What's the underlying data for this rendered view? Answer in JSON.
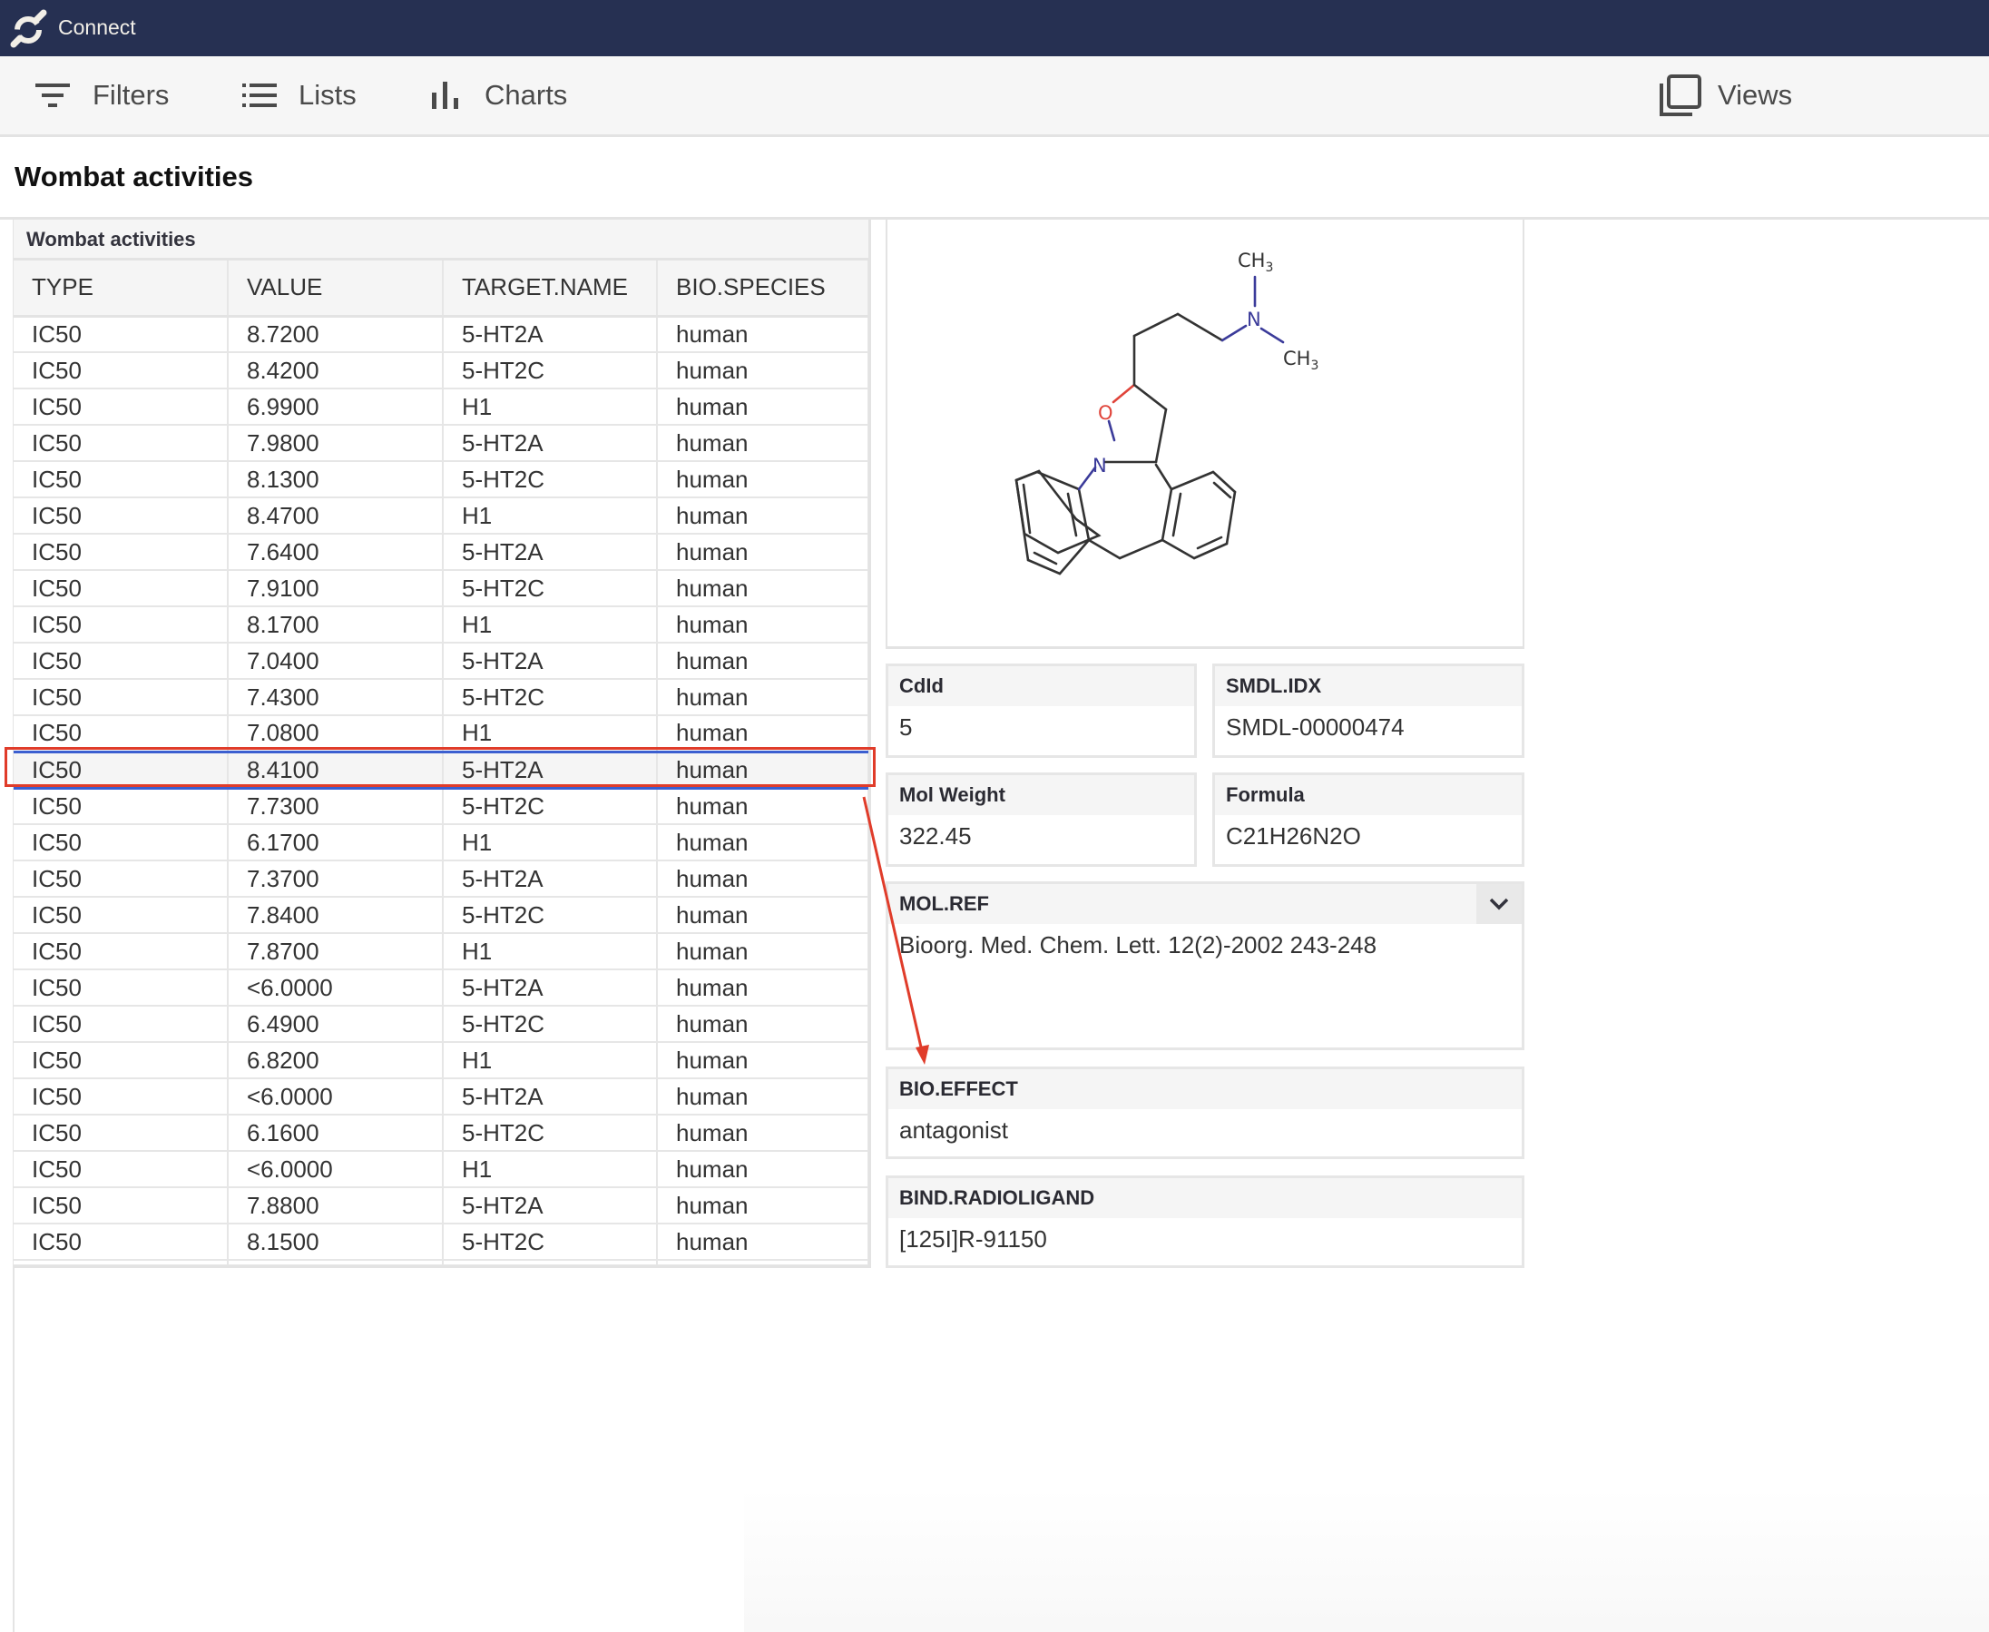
{
  "app": {
    "title": "Connect",
    "logo_icon": "connect-logo-icon",
    "header_color": "#263052"
  },
  "toolbar": {
    "filters_label": "Filters",
    "filters_icon": "filter-icon",
    "lists_label": "Lists",
    "lists_icon": "list-icon",
    "charts_label": "Charts",
    "charts_icon": "bar-chart-icon",
    "views_label": "Views",
    "views_icon": "views-icon"
  },
  "page": {
    "title": "Wombat activities"
  },
  "table": {
    "title": "Wombat activities",
    "columns": [
      "TYPE",
      "VALUE",
      "TARGET.NAME",
      "BIO.SPECIES"
    ],
    "selected_index": 12,
    "rows": [
      [
        "IC50",
        "8.7200",
        "5-HT2A",
        "human"
      ],
      [
        "IC50",
        "8.4200",
        "5-HT2C",
        "human"
      ],
      [
        "IC50",
        "6.9900",
        "H1",
        "human"
      ],
      [
        "IC50",
        "7.9800",
        "5-HT2A",
        "human"
      ],
      [
        "IC50",
        "8.1300",
        "5-HT2C",
        "human"
      ],
      [
        "IC50",
        "8.4700",
        "H1",
        "human"
      ],
      [
        "IC50",
        "7.6400",
        "5-HT2A",
        "human"
      ],
      [
        "IC50",
        "7.9100",
        "5-HT2C",
        "human"
      ],
      [
        "IC50",
        "8.1700",
        "H1",
        "human"
      ],
      [
        "IC50",
        "7.0400",
        "5-HT2A",
        "human"
      ],
      [
        "IC50",
        "7.4300",
        "5-HT2C",
        "human"
      ],
      [
        "IC50",
        "7.0800",
        "H1",
        "human"
      ],
      [
        "IC50",
        "8.4100",
        "5-HT2A",
        "human"
      ],
      [
        "IC50",
        "7.7300",
        "5-HT2C",
        "human"
      ],
      [
        "IC50",
        "6.1700",
        "H1",
        "human"
      ],
      [
        "IC50",
        "7.3700",
        "5-HT2A",
        "human"
      ],
      [
        "IC50",
        "7.8400",
        "5-HT2C",
        "human"
      ],
      [
        "IC50",
        "7.8700",
        "H1",
        "human"
      ],
      [
        "IC50",
        "<6.0000",
        "5-HT2A",
        "human"
      ],
      [
        "IC50",
        "6.4900",
        "5-HT2C",
        "human"
      ],
      [
        "IC50",
        "6.8200",
        "H1",
        "human"
      ],
      [
        "IC50",
        "<6.0000",
        "5-HT2A",
        "human"
      ],
      [
        "IC50",
        "6.1600",
        "5-HT2C",
        "human"
      ],
      [
        "IC50",
        "<6.0000",
        "H1",
        "human"
      ],
      [
        "IC50",
        "7.8800",
        "5-HT2A",
        "human"
      ],
      [
        "IC50",
        "8.1500",
        "5-HT2C",
        "human"
      ]
    ]
  },
  "structure": {
    "labels": {
      "ch3_top": "CH",
      "ch3_right": "CH",
      "subscript": "3",
      "n_amine": "N",
      "n_ring": "N",
      "o_ring": "O"
    },
    "colors": {
      "bond": "#333333",
      "nitrogen": "#3b3b9a",
      "oxygen": "#e0443a"
    }
  },
  "details": {
    "cdid": {
      "label": "CdId",
      "value": "5"
    },
    "smdl_idx": {
      "label": "SMDL.IDX",
      "value": "SMDL-00000474"
    },
    "mol_weight": {
      "label": "Mol Weight",
      "value": "322.45"
    },
    "formula": {
      "label": "Formula",
      "value": "C21H26N2O"
    },
    "mol_ref": {
      "label": "MOL.REF",
      "value": "Bioorg. Med. Chem. Lett. 12(2)-2002 243-248",
      "toggle_icon": "chevron-down-icon"
    },
    "bio_effect": {
      "label": "BIO.EFFECT",
      "value": "antagonist"
    },
    "bind_radioligand": {
      "label": "BIND.RADIOLIGAND",
      "value": "[125I]R-91150"
    }
  },
  "annotation": {
    "highlight_color": "#e03c2a",
    "selection_color": "#3b5fd0"
  }
}
